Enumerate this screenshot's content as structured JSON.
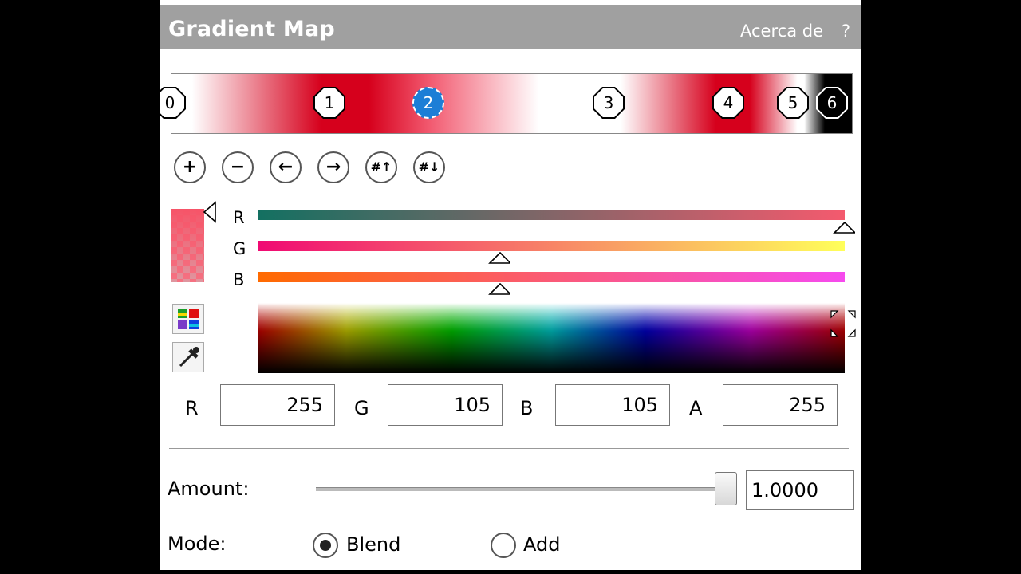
{
  "header": {
    "title": "Gradient Map",
    "about_label": "Acerca de",
    "help_label": "?"
  },
  "gradient": {
    "stops": [
      {
        "label": "0",
        "color": "#ffffff"
      },
      {
        "label": "1",
        "color": "#d6001c"
      },
      {
        "label": "2",
        "color": "#f25a70",
        "selected": true
      },
      {
        "label": "3",
        "color": "#ffffff"
      },
      {
        "label": "4",
        "color": "#d6001c"
      },
      {
        "label": "5",
        "color": "#ffffff"
      },
      {
        "label": "6",
        "color": "#000000"
      }
    ]
  },
  "toolbar": {
    "add": "+",
    "remove": "−",
    "move_left": "←",
    "move_right": "→",
    "distribute_up": "#↑",
    "distribute_down": "#↓"
  },
  "channels": {
    "r_label": "R",
    "g_label": "G",
    "b_label": "B"
  },
  "values": {
    "r_label": "R",
    "r": "255",
    "g_label": "G",
    "g": "105",
    "b_label": "B",
    "b": "105",
    "a_label": "A",
    "a": "255"
  },
  "amount": {
    "label": "Amount:",
    "value": "1.0000",
    "fraction": 1.0
  },
  "mode": {
    "label": "Mode:",
    "options": [
      "Blend",
      "Add"
    ],
    "selected": "Blend"
  },
  "colors": {
    "accent": "#1c7ed6",
    "stop_red": "#d6001c",
    "titlebar": "#a0a0a0"
  }
}
